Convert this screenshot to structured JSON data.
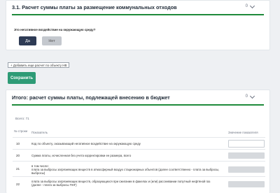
{
  "section1": {
    "title": "3.1. Расчет суммы платы за размещение коммунальных отходов",
    "toggle_value": "0"
  },
  "question": {
    "text": "Это негативное воздействие на окружающую среду?",
    "yes_label": "Да",
    "no_label": "Нет"
  },
  "add_link_label": "+ Добавить еще расчет по объекту НВ",
  "save_label": "Сохранить",
  "section2": {
    "title": "Итого: расчет суммы платы, подлежащей внесению в бюджет",
    "toggle_value": "0"
  },
  "table": {
    "total": "Всего: 71",
    "col_num": "№ строки",
    "col_indicator": "Показатель",
    "col_value": "Значение показателя",
    "rows": [
      {
        "num": "10",
        "text": "Код по объекту, оказывающий негативное воздействие на окружающую среду"
      },
      {
        "num": "20",
        "text": "Сумма платы, исчисленная без учета корректировки ее размера, всего"
      },
      {
        "num": "21",
        "text": "в том числе:\nплата за выбросы загрязняющих веществ в атмосферный воздух стационарных объектов (далее соответственно - плата за выбросы, выбросы)"
      },
      {
        "num": "22",
        "text": "плата за выбросы загрязняющих веществ, образующихся при сжигании в факелах и (или) рассеивании попутный нефтяной газ (далее - плата за выбросы ПНГ)"
      }
    ]
  },
  "colors": {
    "accent_green": "#1f8a3b",
    "save_button": "#2e9b76",
    "yes_button": "#2e3b55"
  }
}
